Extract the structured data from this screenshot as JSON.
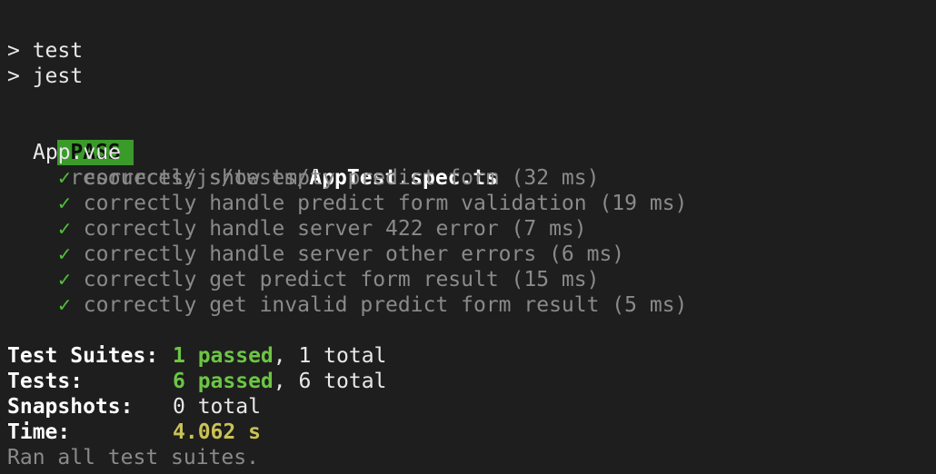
{
  "script_lines": [
    "> test",
    "> jest"
  ],
  "result": {
    "badge": "PASS",
    "path_dim": "resources/js/tests/",
    "file": "AppTest.spec.ts",
    "suite": "App.vue",
    "check_glyph": "✓",
    "tests": [
      "correctly show empty predict form (32 ms)",
      "correctly handle predict form validation (19 ms)",
      "correctly handle server 422 error (7 ms)",
      "correctly handle server other errors (6 ms)",
      "correctly get predict form result (15 ms)",
      "correctly get invalid predict form result (5 ms)"
    ]
  },
  "summary": {
    "suites_label": "Test Suites:",
    "suites_passed": "1 passed",
    "suites_total": ", 1 total",
    "tests_label": "Tests:",
    "tests_passed": "6 passed",
    "tests_total": ", 6 total",
    "snapshots_label": "Snapshots:",
    "snapshots_value": "0 total",
    "time_label": "Time:",
    "time_value": "4.062 s",
    "footer": "Ran all test suites."
  },
  "colors": {
    "background": "#1e1e1e",
    "pass_badge": "#3a9a2a",
    "passed_text": "#6cc644",
    "time_text": "#c9c255",
    "dim_text": "#8a8a8a"
  }
}
